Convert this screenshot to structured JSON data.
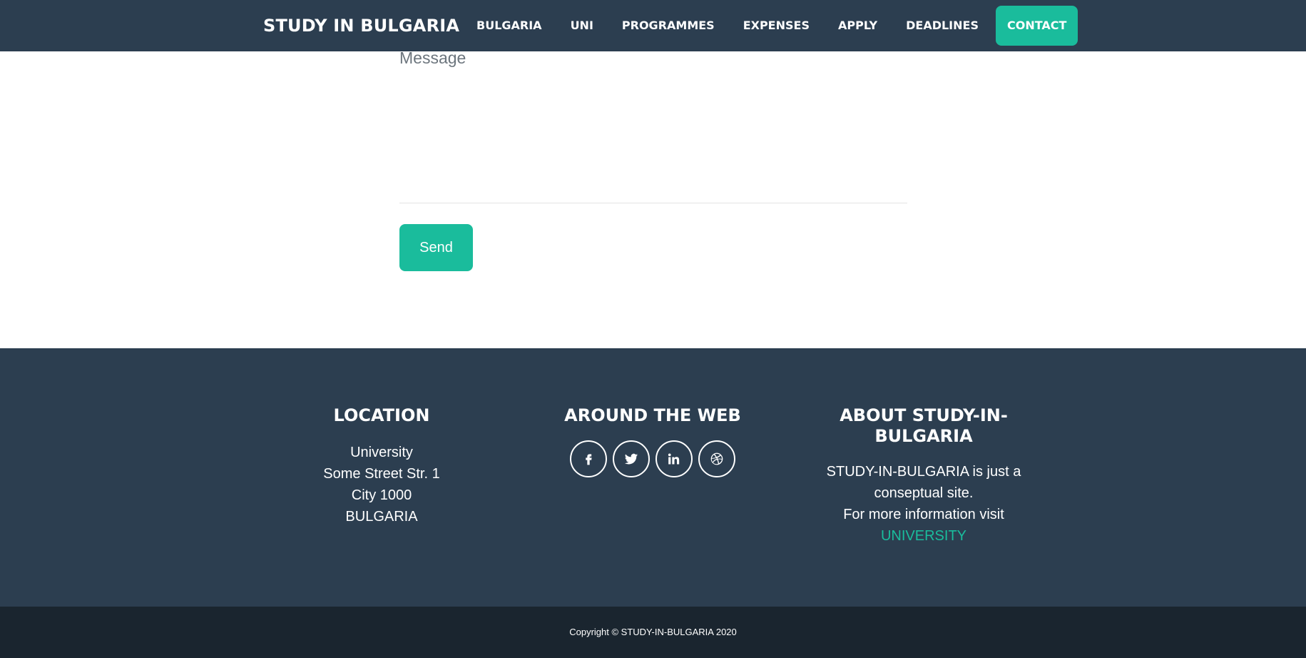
{
  "navbar": {
    "brand": "STUDY IN BULGARIA",
    "links": [
      {
        "label": "BULGARIA"
      },
      {
        "label": "UNI"
      },
      {
        "label": "PROGRAMMES"
      },
      {
        "label": "EXPENSES"
      },
      {
        "label": "APPLY"
      },
      {
        "label": "DEADLINES"
      },
      {
        "label": "CONTACT",
        "active": true
      }
    ]
  },
  "form": {
    "message_placeholder": "Message",
    "message_value": "",
    "send_label": "Send"
  },
  "footer": {
    "location": {
      "title": "LOCATION",
      "lines": [
        "University",
        "Some Street Str. 1",
        "City 1000",
        "BULGARIA"
      ]
    },
    "web": {
      "title": "AROUND THE WEB",
      "icons": [
        "facebook-icon",
        "twitter-icon",
        "linkedin-icon",
        "dribbble-icon"
      ]
    },
    "about": {
      "title": "ABOUT STUDY-IN-BULGARIA",
      "line1": "STUDY-IN-BULGARIA is just a conseptual site.",
      "line2": "For more information visit",
      "link_label": "UNIVERSITY"
    }
  },
  "copyright": "Copyright © STUDY-IN-BULGARIA 2020",
  "colors": {
    "navbar_bg": "#2c3e50",
    "accent": "#1abc9c",
    "footer_bg": "#2c3e50",
    "copyright_bg": "#1a252f"
  }
}
